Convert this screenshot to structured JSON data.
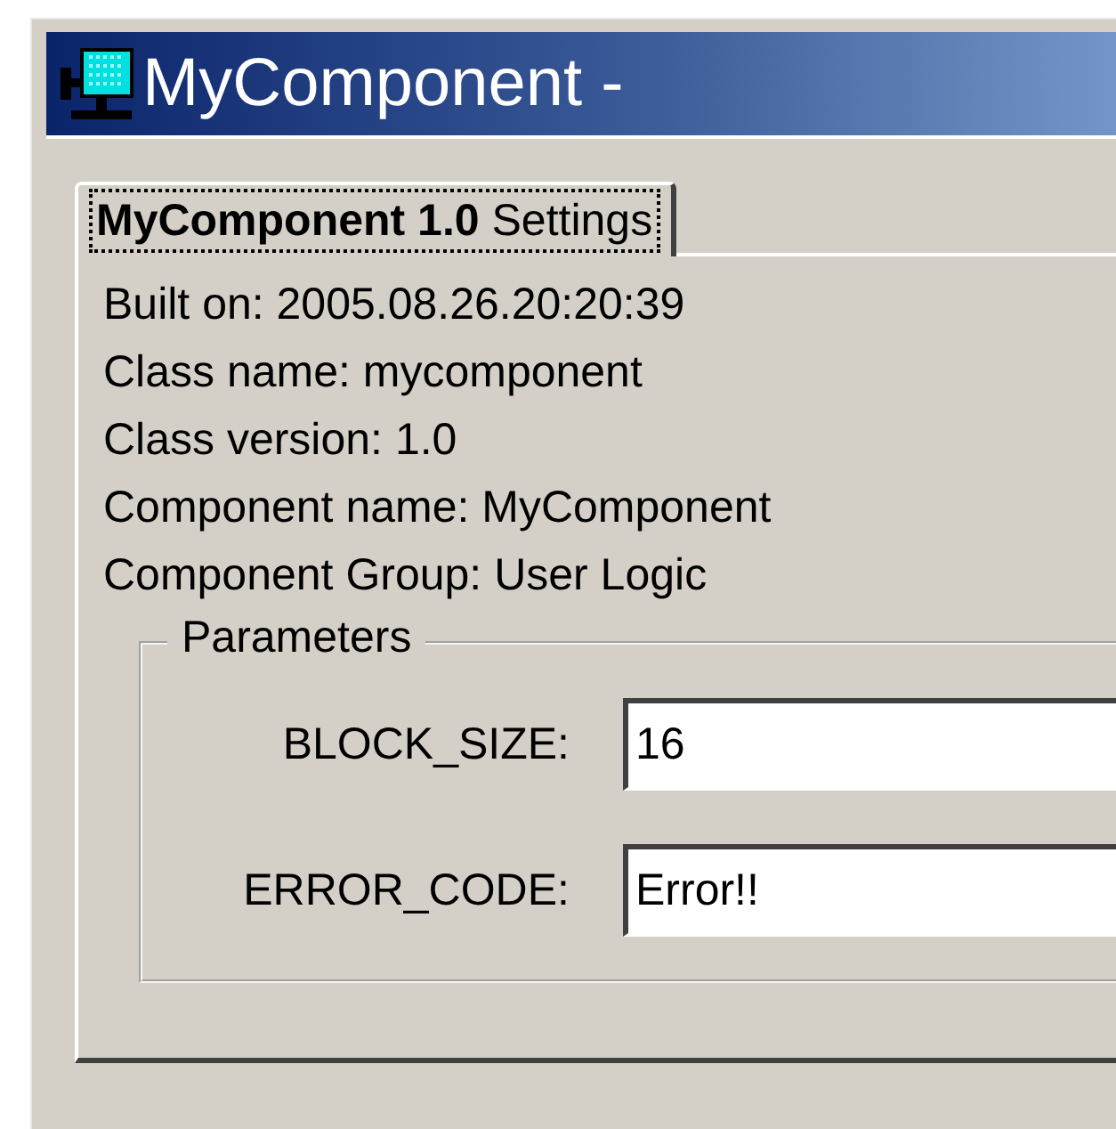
{
  "window": {
    "title": "MyComponent -"
  },
  "tabs": [
    {
      "label": "**MyComponent 1.0** Settings",
      "selected": true
    }
  ],
  "info_lines": [
    "Built on: 2005.08.26.20:20:39",
    "Class name: mycomponent",
    "Class version: 1.0",
    "Component name: MyComponent",
    "Component Group: User Logic"
  ],
  "parameters": {
    "title": "Parameters",
    "fields": [
      {
        "label": "BLOCK_SIZE:",
        "value": "16"
      },
      {
        "label": "ERROR_CODE:",
        "value": "Error!!"
      }
    ]
  }
}
